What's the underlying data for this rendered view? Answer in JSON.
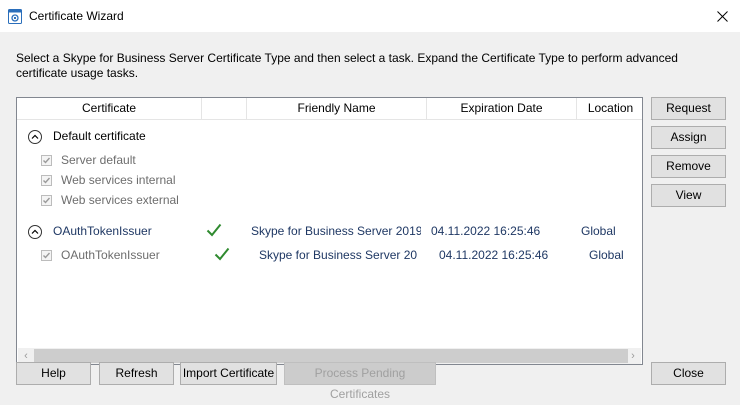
{
  "window": {
    "title": "Certificate Wizard",
    "close_glyph": "✕"
  },
  "instructions": "Select a Skype for Business Server Certificate Type and then select a task. Expand the Certificate Type to perform advanced certificate usage tasks.",
  "columns": {
    "certificate": "Certificate",
    "friendly_name": "Friendly Name",
    "expiration_date": "Expiration Date",
    "location": "Location"
  },
  "groups": [
    {
      "label": "Default certificate",
      "children": [
        {
          "label": "Server default",
          "checked": true
        },
        {
          "label": "Web services internal",
          "checked": true
        },
        {
          "label": "Web services external",
          "checked": true
        }
      ]
    },
    {
      "label": "OAuthTokenIssuer",
      "friendly_name": "Skype for Business Server 2019 (",
      "expiration": "04.11.2022 16:25:46",
      "location": "Global",
      "status_icon": "check-icon",
      "children": [
        {
          "label": "OAuthTokenIssuer",
          "checked": true,
          "friendly_name": "Skype for Business Server 20",
          "expiration": "04.11.2022 16:25:46",
          "location": "Global",
          "status_icon": "check-icon"
        }
      ]
    }
  ],
  "side_buttons": {
    "request": "Request",
    "assign": "Assign",
    "remove": "Remove",
    "view": "View"
  },
  "bottom_buttons": {
    "help": "Help",
    "refresh": "Refresh",
    "import": "Import Certificate",
    "process_pending": "Process Pending Certificates",
    "close": "Close"
  },
  "scrollbar": {
    "left_arrow": "‹",
    "right_arrow": "›"
  },
  "colors": {
    "check": "#2f8a2f",
    "text_blue": "#1f3864",
    "disabled_text": "#6d6d6d"
  }
}
